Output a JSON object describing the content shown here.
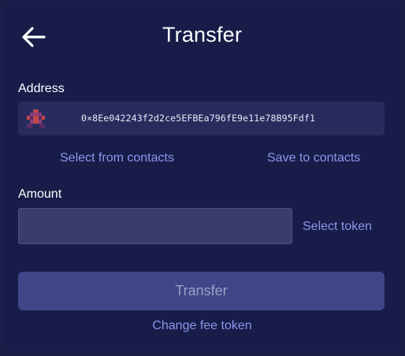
{
  "header": {
    "back_icon": "arrow-left-icon",
    "title": "Transfer"
  },
  "address": {
    "label": "Address",
    "avatar_icon": "identicon-avatar",
    "value": "0×8Ee042243f2d2ce5EFBEa796fE9e11e78B95Fdf1",
    "select_from_contacts": "Select from contacts",
    "save_to_contacts": "Save to contacts"
  },
  "amount": {
    "label": "Amount",
    "value": "",
    "placeholder": "",
    "select_token": "Select token"
  },
  "actions": {
    "transfer_label": "Transfer",
    "change_fee_token": "Change fee token"
  },
  "colors": {
    "background": "#171c49",
    "input_background": "#393d6c",
    "address_background": "#272c5d",
    "link": "#8e95ea",
    "button_background": "#404488",
    "button_text": "#9ca0c5"
  }
}
